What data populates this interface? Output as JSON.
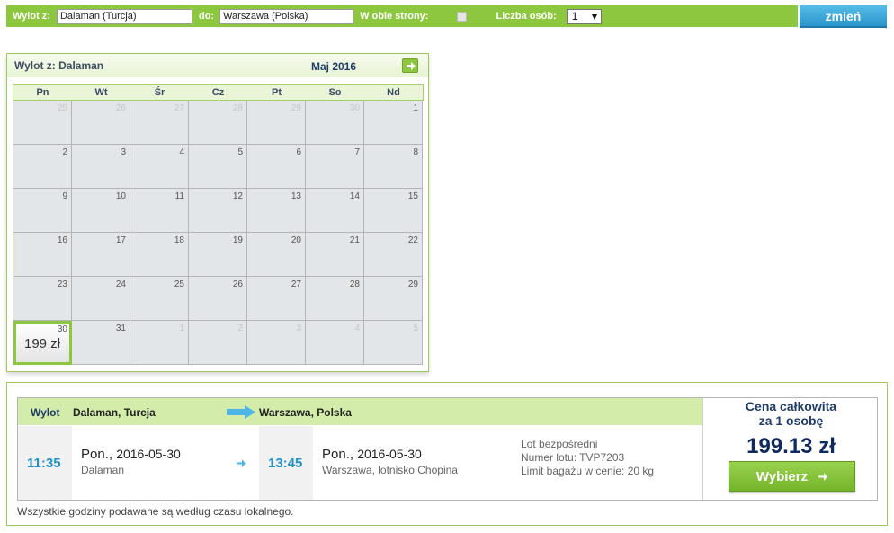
{
  "search": {
    "from_label": "Wylot z:",
    "from_value": "Dalaman (Turcja)",
    "to_label": "do:",
    "to_value": "Warszawa (Polska)",
    "roundtrip_label": "W obie strony:",
    "persons_label": "Liczba osób:",
    "persons_value": "1",
    "submit_label": "zmień"
  },
  "calendar": {
    "title": "Wylot z: Dalaman",
    "month": "Maj 2016",
    "weekdays": [
      "Pn",
      "Wt",
      "Śr",
      "Cz",
      "Pt",
      "So",
      "Nd"
    ],
    "weeks": [
      [
        "25",
        "26",
        "27",
        "28",
        "29",
        "30",
        "1"
      ],
      [
        "2",
        "3",
        "4",
        "5",
        "6",
        "7",
        "8"
      ],
      [
        "9",
        "10",
        "11",
        "12",
        "13",
        "14",
        "15"
      ],
      [
        "16",
        "17",
        "18",
        "19",
        "20",
        "21",
        "22"
      ],
      [
        "23",
        "24",
        "25",
        "26",
        "27",
        "28",
        "29"
      ],
      [
        "30",
        "31",
        "1",
        "2",
        "3",
        "4",
        "5"
      ]
    ],
    "selected_price": "199 zł"
  },
  "flight": {
    "header": {
      "wylot_label": "Wylot",
      "from_city": "Dalaman, Turcja",
      "to_city": "Warszawa, Polska"
    },
    "departure": {
      "time": "11:35",
      "day": "Pon.,",
      "date": "2016-05-30",
      "place": "Dalaman"
    },
    "arrival": {
      "time": "13:45",
      "day": "Pon.,",
      "date": "2016-05-30",
      "place": "Warszawa, lotnisko Chopina"
    },
    "meta": [
      "Lot bezpośredni",
      "Numer lotu: TVP7203",
      "Limit bagażu w cenie: 20 kg"
    ],
    "price_label_1": "Cena całkowita",
    "price_label_2": "za 1 osobę",
    "total": "199.13 zł",
    "choose_label": "Wybierz",
    "note": "Wszystkie godziny podawane są według czasu lokalnego."
  },
  "colors": {
    "accent": "#8dc63f",
    "button_blue": "#2a95cb",
    "time_blue": "#2293c9"
  }
}
